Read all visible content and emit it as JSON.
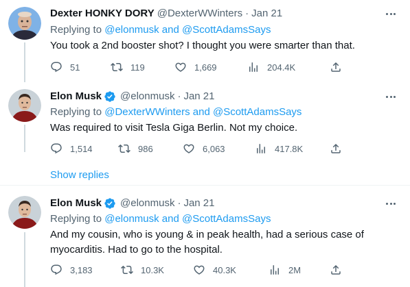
{
  "tweets": [
    {
      "name": "Dexter HONKY DORY",
      "handle": "@DexterWWinters",
      "sep": "·",
      "date": "Jan 21",
      "replying_prefix": "Replying to",
      "replying_targets": "@elonmusk and @ScottAdamsSays",
      "text": "You took a 2nd booster shot? I thought you were smarter than that.",
      "replies": "51",
      "retweets": "119",
      "likes": "1,669",
      "views": "204.4K",
      "verified": false
    },
    {
      "name": "Elon Musk",
      "handle": "@elonmusk",
      "sep": "·",
      "date": "Jan 21",
      "replying_prefix": "Replying to",
      "replying_targets": "@DexterWWinters and @ScottAdamsSays",
      "text": "Was required to visit Tesla Giga Berlin. Not my choice.",
      "replies": "1,514",
      "retweets": "986",
      "likes": "6,063",
      "views": "417.8K",
      "verified": true
    },
    {
      "name": "Elon Musk",
      "handle": "@elonmusk",
      "sep": "·",
      "date": "Jan 21",
      "replying_prefix": "Replying to",
      "replying_targets": "@elonmusk and @ScottAdamsSays",
      "text": "And my cousin, who is young & in peak health, had a serious case of myocarditis. Had to go to the hospital.",
      "replies": "3,183",
      "retweets": "10.3K",
      "likes": "40.3K",
      "views": "2M",
      "verified": true
    }
  ],
  "show_replies": "Show replies",
  "colors": {
    "accent": "#1d9bf0",
    "muted": "#536471",
    "divider": "#eff3f4",
    "thread_line": "#cfd9de"
  }
}
